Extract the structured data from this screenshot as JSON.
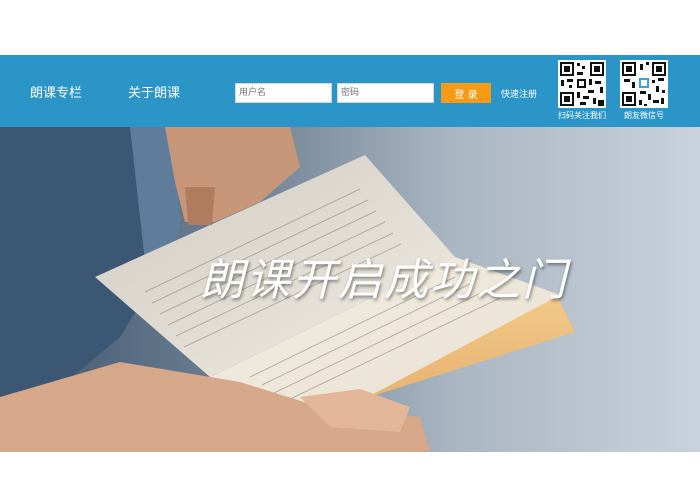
{
  "header": {
    "nav": [
      {
        "label": "朗课专栏"
      },
      {
        "label": "关于朗课"
      }
    ],
    "login": {
      "username_placeholder": "用户名",
      "password_placeholder": "密码",
      "submit_label": "登 录",
      "register_label": "快速注册"
    },
    "qr_codes": [
      {
        "caption": "扫码关注我们",
        "icon": "qr-code-icon"
      },
      {
        "caption": "朗友微信号",
        "icon": "qr-code-icon"
      }
    ]
  },
  "banner": {
    "slogan": "朗课开启成功之门",
    "image": "hands-holding-open-book-photo"
  },
  "colors": {
    "header_bg": "#2c95c8",
    "login_button": "#f79a16",
    "text_light": "#ffffff"
  }
}
